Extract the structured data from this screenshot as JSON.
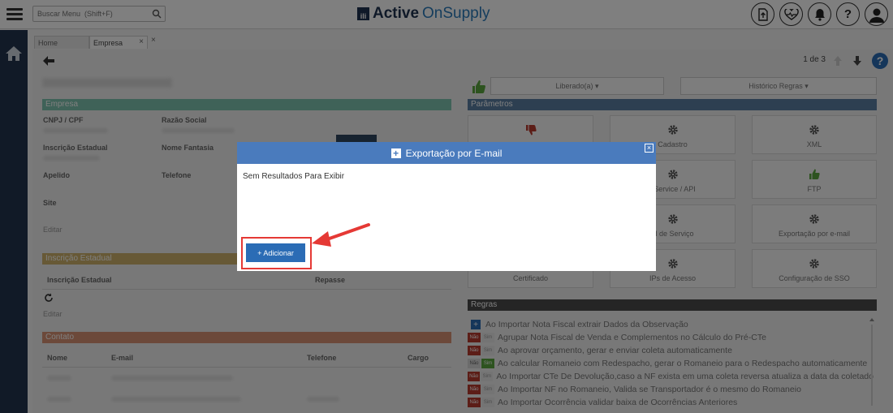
{
  "search": {
    "placeholder": "Buscar Menu  (Shift+F)"
  },
  "logo": {
    "mark": "ili",
    "bold": "Active",
    "light": "OnSupply"
  },
  "tabs": [
    {
      "label": "Home"
    },
    {
      "label": "Empresa"
    }
  ],
  "tab_close": "×",
  "pager": {
    "text": "1 de 3"
  },
  "left": {
    "section_empresa": "Empresa",
    "cnpj": "CNPJ / CPF",
    "razao": "Razão Social",
    "ie": "Inscrição Estadual",
    "fantasia": "Nome Fantasia",
    "apelido": "Apelido",
    "telefone": "Telefone",
    "site": "Site",
    "editar": "Editar",
    "section_ie": "Inscrição Estadual",
    "ie_col1": "Inscrição Estadual",
    "ie_col2": "Repasse",
    "section_contato": "Contato",
    "contato_cols": [
      "Nome",
      "E-mail",
      "Telefone",
      "Cargo"
    ]
  },
  "right": {
    "liberado": "Liberado(a) ▾",
    "historico": "Histórico Regras ▾",
    "section_param": "Parâmetros",
    "cards": [
      "",
      "Cadastro",
      "XML",
      "",
      "bService / API",
      "FTP",
      "",
      "el de Serviço",
      "Exportação por e-mail",
      "Certificado",
      "IPs de Acesso",
      "Configuração de SSO"
    ],
    "section_regras": "Regras",
    "regras": [
      "Ao Importar Nota Fiscal extrair Dados da Observação",
      "Agrupar Nota Fiscal de Venda e Complementos no Cálculo do Pré-CTe",
      "Ao aprovar orçamento, gerar e enviar coleta automaticamente",
      "Ao calcular Romaneio com Redespacho, gerar o Romaneio para o Redespacho automaticamente",
      "Ao Importar CTe De Devolução,caso a NF exista em uma coleta reversa atualiza a data da coletado",
      "Ao Importar NF no Romaneio, Valida se Transportador é o mesmo do Romaneio",
      "Ao Importar Ocorrência validar baixa de Ocorrências Anteriores"
    ],
    "badge_nao": "Não",
    "badge_sim": "Sim"
  },
  "modal": {
    "title": "Exportação por E-mail",
    "message": "Sem Resultados Para Exibir",
    "add_button": "+ Adicionar",
    "close": "×"
  },
  "colors": {
    "primary": "#4a7bbd",
    "button": "#2b6cb5",
    "highlight": "#e53935",
    "sidebar": "#22354e"
  }
}
